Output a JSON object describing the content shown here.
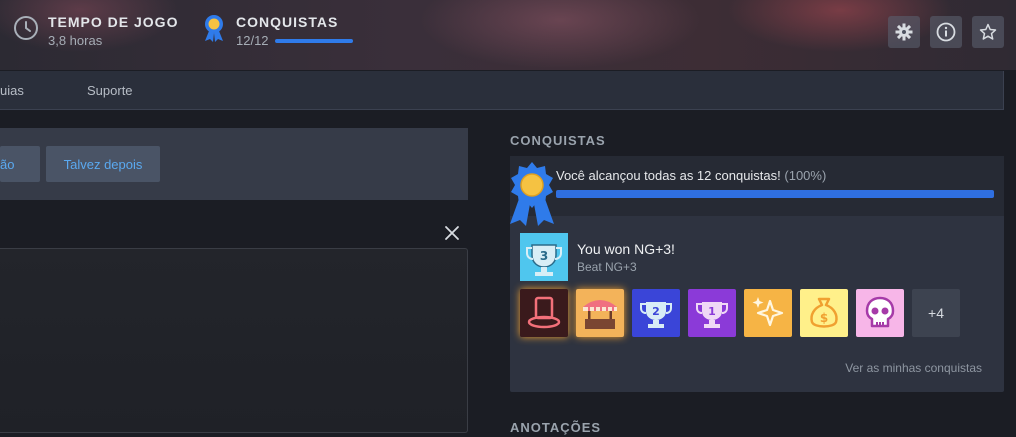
{
  "header": {
    "playtime": {
      "title": "TEMPO DE JOGO",
      "value": "3,8 horas",
      "icon": "clock-icon"
    },
    "achievements": {
      "title": "CONQUISTAS",
      "value": "12/12",
      "progress": 1.0,
      "icon": "medal-icon"
    },
    "buttons": [
      {
        "name": "settings",
        "icon": "gear-icon"
      },
      {
        "name": "info",
        "icon": "info-icon"
      },
      {
        "name": "favorite",
        "icon": "star-icon"
      }
    ]
  },
  "subnav": {
    "item1": "uias",
    "item2": "Suporte"
  },
  "left": {
    "button1": "ão",
    "button2": "Talvez depois"
  },
  "achievements_section": {
    "title": "CONQUISTAS",
    "summary": "Você alcançou todas as 12 conquistas!",
    "summary_pct": "(100%)",
    "progress": 1.0,
    "recent": {
      "name": "You won NG+3!",
      "desc": "Beat NG+3"
    },
    "badges": [
      {
        "name": "top-hat",
        "bg": "#3a1a1c"
      },
      {
        "name": "market-stall",
        "bg": "#f3b35a"
      },
      {
        "name": "trophy-2",
        "bg": "#3a45d8"
      },
      {
        "name": "trophy-1",
        "bg": "#8b3ad8"
      },
      {
        "name": "sparkles",
        "bg": "#f6b445"
      },
      {
        "name": "money-bag",
        "bg": "#fff08a"
      },
      {
        "name": "skull",
        "bg": "#f7b6e8"
      }
    ],
    "more": "+4",
    "see_mine": "Ver as minhas conquistas"
  },
  "notes_section": {
    "title": "ANOTAÇÕES"
  },
  "colors": {
    "accent": "#2f6fe0",
    "link": "#5aa9f0"
  }
}
